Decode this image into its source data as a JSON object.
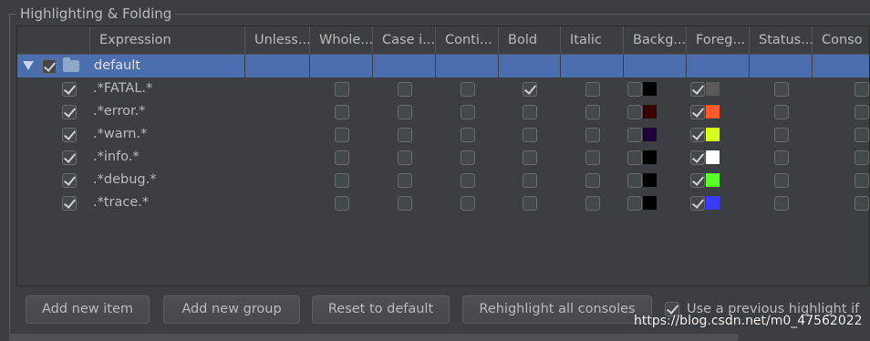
{
  "panel": {
    "title": "Highlighting & Folding"
  },
  "table": {
    "columns": [
      "",
      "Expression",
      "Unless...",
      "Whole...",
      "Case i...",
      "Conti...",
      "Bold",
      "Italic",
      "Backg...",
      "Foreg...",
      "Status...",
      "Conso"
    ],
    "group": {
      "name": "default",
      "checked": true,
      "expanded": true
    },
    "rows": [
      {
        "enabled": true,
        "expression": ".*FATAL.*",
        "whole": false,
        "case": false,
        "cont": false,
        "bold": true,
        "italic": false,
        "bg_on": false,
        "bg_color": "#000000",
        "fg_on": true,
        "fg_color": "#5a5a5a",
        "status": false,
        "console": false
      },
      {
        "enabled": true,
        "expression": ".*error.*",
        "whole": false,
        "case": false,
        "cont": false,
        "bold": false,
        "italic": false,
        "bg_on": false,
        "bg_color": "#3a0000",
        "fg_on": true,
        "fg_color": "#ff5a2a",
        "status": false,
        "console": false
      },
      {
        "enabled": true,
        "expression": ".*warn.*",
        "whole": false,
        "case": false,
        "cont": false,
        "bold": false,
        "italic": false,
        "bg_on": false,
        "bg_color": "#20003a",
        "fg_on": true,
        "fg_color": "#d6ff1f",
        "status": false,
        "console": false
      },
      {
        "enabled": true,
        "expression": ".*info.*",
        "whole": false,
        "case": false,
        "cont": false,
        "bold": false,
        "italic": false,
        "bg_on": false,
        "bg_color": "#000000",
        "fg_on": true,
        "fg_color": "#ffffff",
        "status": false,
        "console": false
      },
      {
        "enabled": true,
        "expression": ".*debug.*",
        "whole": false,
        "case": false,
        "cont": false,
        "bold": false,
        "italic": false,
        "bg_on": false,
        "bg_color": "#000000",
        "fg_on": true,
        "fg_color": "#5cff2a",
        "status": false,
        "console": false
      },
      {
        "enabled": true,
        "expression": ".*trace.*",
        "whole": false,
        "case": false,
        "cont": false,
        "bold": false,
        "italic": false,
        "bg_on": false,
        "bg_color": "#000000",
        "fg_on": true,
        "fg_color": "#3a3aff",
        "status": false,
        "console": false
      }
    ]
  },
  "buttons": {
    "add_item": "Add new item",
    "add_group": "Add new group",
    "reset": "Reset to default",
    "rehighlight": "Rehighlight all consoles"
  },
  "option": {
    "label": "Use a previous highlight if",
    "checked": true
  },
  "watermark": "https://blog.csdn.net/m0_47562022",
  "colors": {
    "background": "#3c3f41",
    "selection": "#4b6eaf",
    "text": "#bbbbbb"
  }
}
